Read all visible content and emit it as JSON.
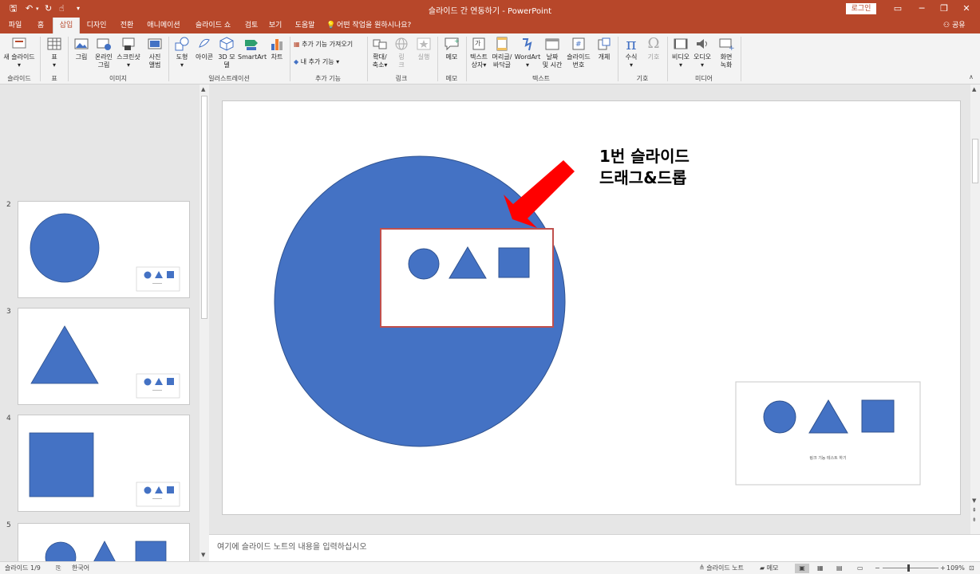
{
  "titlebar": {
    "title": "슬라이드 간 연동하기  -  PowerPoint",
    "login": "로그인",
    "quick_access": [
      "save-icon",
      "undo-icon",
      "redo-icon",
      "touch-mode-icon",
      "customize-icon"
    ]
  },
  "tabs": [
    {
      "label": "파일"
    },
    {
      "label": "홈"
    },
    {
      "label": "삽입"
    },
    {
      "label": "디자인"
    },
    {
      "label": "전환"
    },
    {
      "label": "애니메이션"
    },
    {
      "label": "슬라이드 쇼"
    },
    {
      "label": "검토"
    },
    {
      "label": "보기"
    },
    {
      "label": "도움말"
    },
    {
      "label": "어떤 작업을 원하시나요?"
    }
  ],
  "share_label": "공유",
  "ribbon": {
    "groups": {
      "slides": "슬라이드",
      "table": "표",
      "images": "이미지",
      "illustrations": "일러스트레이션",
      "addins": "추가 기능",
      "links": "링크",
      "comments": "메모",
      "text": "텍스트",
      "symbols": "기호",
      "media": "미디어"
    },
    "buttons": {
      "new_slide": "새 슬라이드",
      "table": "표",
      "pictures": "그림",
      "online_pictures_1": "온라인",
      "online_pictures_2": "그림",
      "screenshot": "스크린샷",
      "photo_album_1": "사진",
      "photo_album_2": "앨범",
      "shapes": "도형",
      "icons": "아이콘",
      "model3d_1": "3D 모",
      "model3d_2": "델",
      "smartart": "SmartArt",
      "chart": "차트",
      "get_addins": "추가 기능 가져오기",
      "my_addins": "내 추가 기능",
      "zoom_1": "확대/",
      "zoom_2": "축소",
      "link_1": "링",
      "link_2": "크",
      "action": "실행",
      "comment": "메모",
      "textbox_1": "텍스트",
      "textbox_2": "상자",
      "header_1": "머리글/",
      "header_2": "바닥글",
      "wordart": "WordArt",
      "datetime_1": "날짜",
      "datetime_2": "및 시간",
      "slidenum_1": "슬라이드",
      "slidenum_2": "번호",
      "object": "개체",
      "equation": "수식",
      "symbol": "기호",
      "video": "비디오",
      "audio": "오디오",
      "screen_rec_1": "화면",
      "screen_rec_2": "녹화"
    }
  },
  "thumbnails": [
    {
      "number": "2"
    },
    {
      "number": "3"
    },
    {
      "number": "4"
    },
    {
      "number": "5"
    }
  ],
  "slide": {
    "annotation_line1": "1번 슬라이드",
    "annotation_line2": "드래그&드롭",
    "linked_caption": "링크 기능 테스트 하기"
  },
  "notes_placeholder": "여기에 슬라이드 노트의 내용을 입력하십시오",
  "status": {
    "slide_counter": "슬라이드 1/9",
    "language": "한국어",
    "notes": "슬라이드 노트",
    "comments": "메모",
    "zoom": "109%"
  },
  "colors": {
    "accent": "#b7472a",
    "shape_fill": "#4472c4",
    "arrow": "#ff0000",
    "highlight_border": "#c0504d"
  }
}
